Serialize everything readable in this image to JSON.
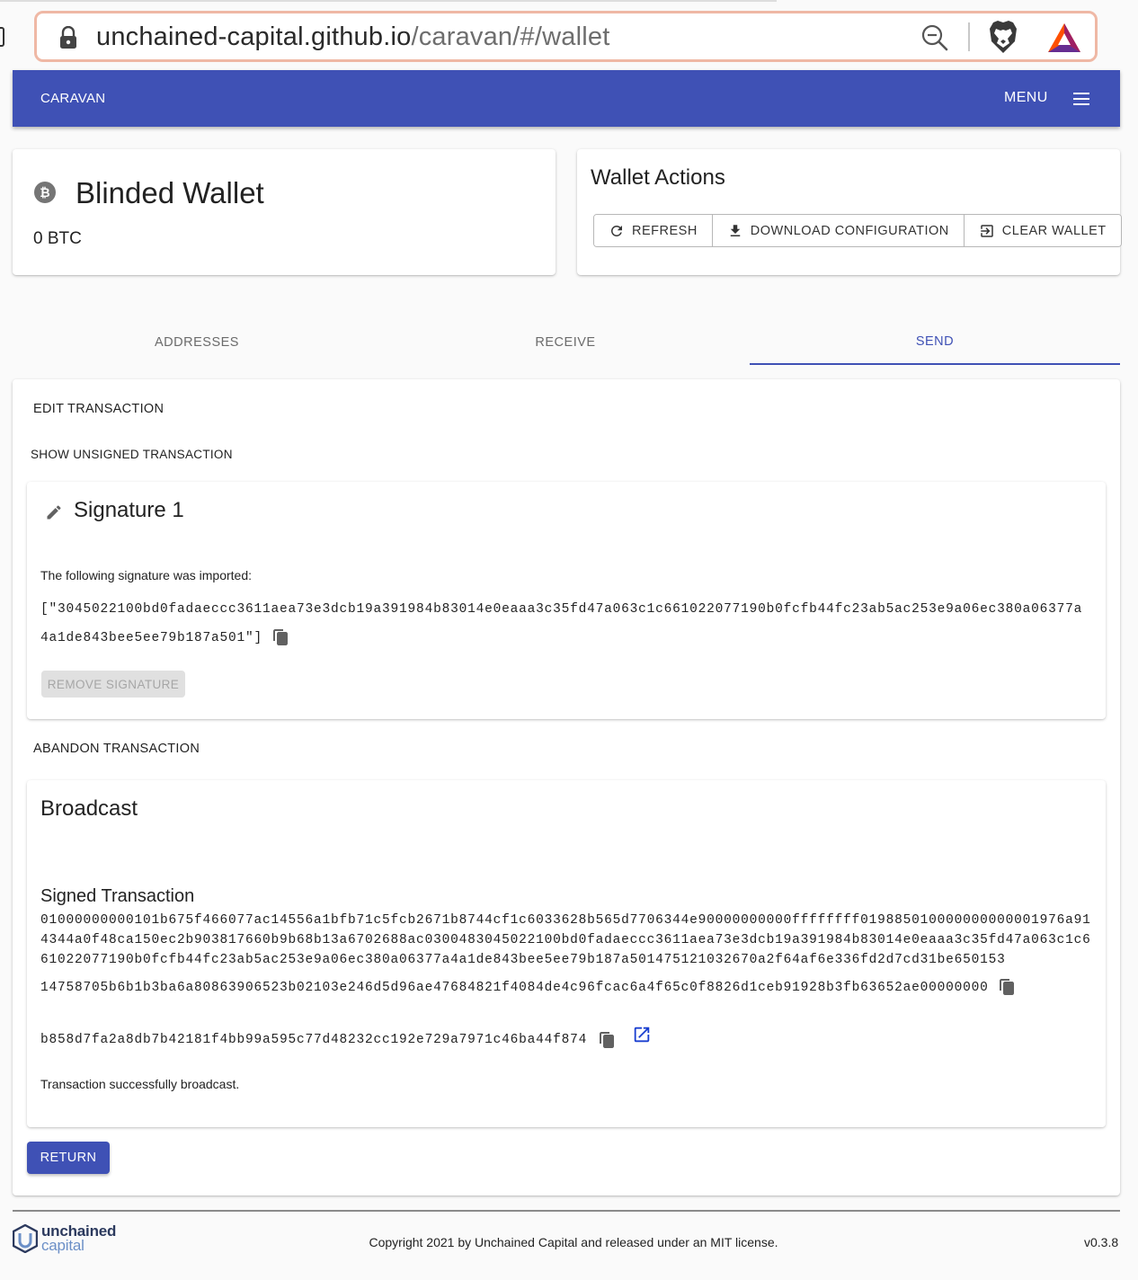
{
  "browser": {
    "url_host": "unchained-capital.github.io",
    "url_path": "/caravan/#/wallet"
  },
  "appbar": {
    "title": "CARAVAN",
    "menu_label": "MENU"
  },
  "wallet": {
    "name": "Blinded Wallet",
    "balance": "0 BTC"
  },
  "actions": {
    "title": "Wallet Actions",
    "refresh": "REFRESH",
    "download": "DOWNLOAD CONFIGURATION",
    "clear": "CLEAR WALLET"
  },
  "tabs": [
    {
      "label": "ADDRESSES",
      "active": false
    },
    {
      "label": "RECEIVE",
      "active": false
    },
    {
      "label": "SEND",
      "active": true
    }
  ],
  "send": {
    "edit_transaction": "EDIT TRANSACTION",
    "show_unsigned": "SHOW UNSIGNED TRANSACTION",
    "signature": {
      "title": "Signature 1",
      "description": "The following signature was imported:",
      "value": "[\"3045022100bd0fadaeccc3611aea73e3dcb19a391984b83014e0eaaa3c35fd47a063c1c661022077190b0fcfb44fc23ab5ac253e9a06ec380a06377a4a1de843bee5ee79b187a501\"]",
      "remove_button": "REMOVE SIGNATURE"
    },
    "abandon_transaction": "ABANDON TRANSACTION",
    "broadcast": {
      "title": "Broadcast",
      "signed_label": "Signed Transaction",
      "signed_value": "01000000000101b675f466077ac14556a1bfb71c5fcb2671b8744cf1c6033628b565d7706344e90000000000ffffffff019885010000000000001976a914344a0f48ca150ec2b903817660b9b68b13a6702688ac0300483045022100bd0fadaeccc3611aea73e3dcb19a391984b83014e0eaaa3c35fd47a063c1c661022077190b0fcfb44fc23ab5ac253e9a06ec380a06377a4a1de843bee5ee79b187a501475121032670a2f64af6e336fd2d7cd31be650153",
      "signed_tail": "14758705b6b1b3ba6a80863906523b02103e246d5d96ae47684821f4084de4c96fcac6a4f65c0f8826d1ceb91928b3fb63652ae00000000",
      "txid": "b858d7fa2a8db7b42181f4bb99a595c77d48232cc192e729a7971c46ba44f874",
      "success": "Transaction successfully broadcast."
    },
    "return_button": "RETURN"
  },
  "footer": {
    "logo_line1": "unchained",
    "logo_line2": "capital",
    "copyright": "Copyright 2021 by Unchained Capital and released under an MIT license.",
    "version": "v0.3.8"
  },
  "colors": {
    "primary": "#3f51b5",
    "url_border": "#efb8a5"
  },
  "icons": [
    "lock-icon",
    "zoom-out-icon",
    "brave-lion-icon",
    "bat-triangle-icon",
    "hamburger-menu-icon",
    "bitcoin-icon",
    "refresh-icon",
    "download-icon",
    "exit-icon",
    "pencil-icon",
    "copy-icon",
    "external-link-icon",
    "unchained-logo-icon"
  ]
}
